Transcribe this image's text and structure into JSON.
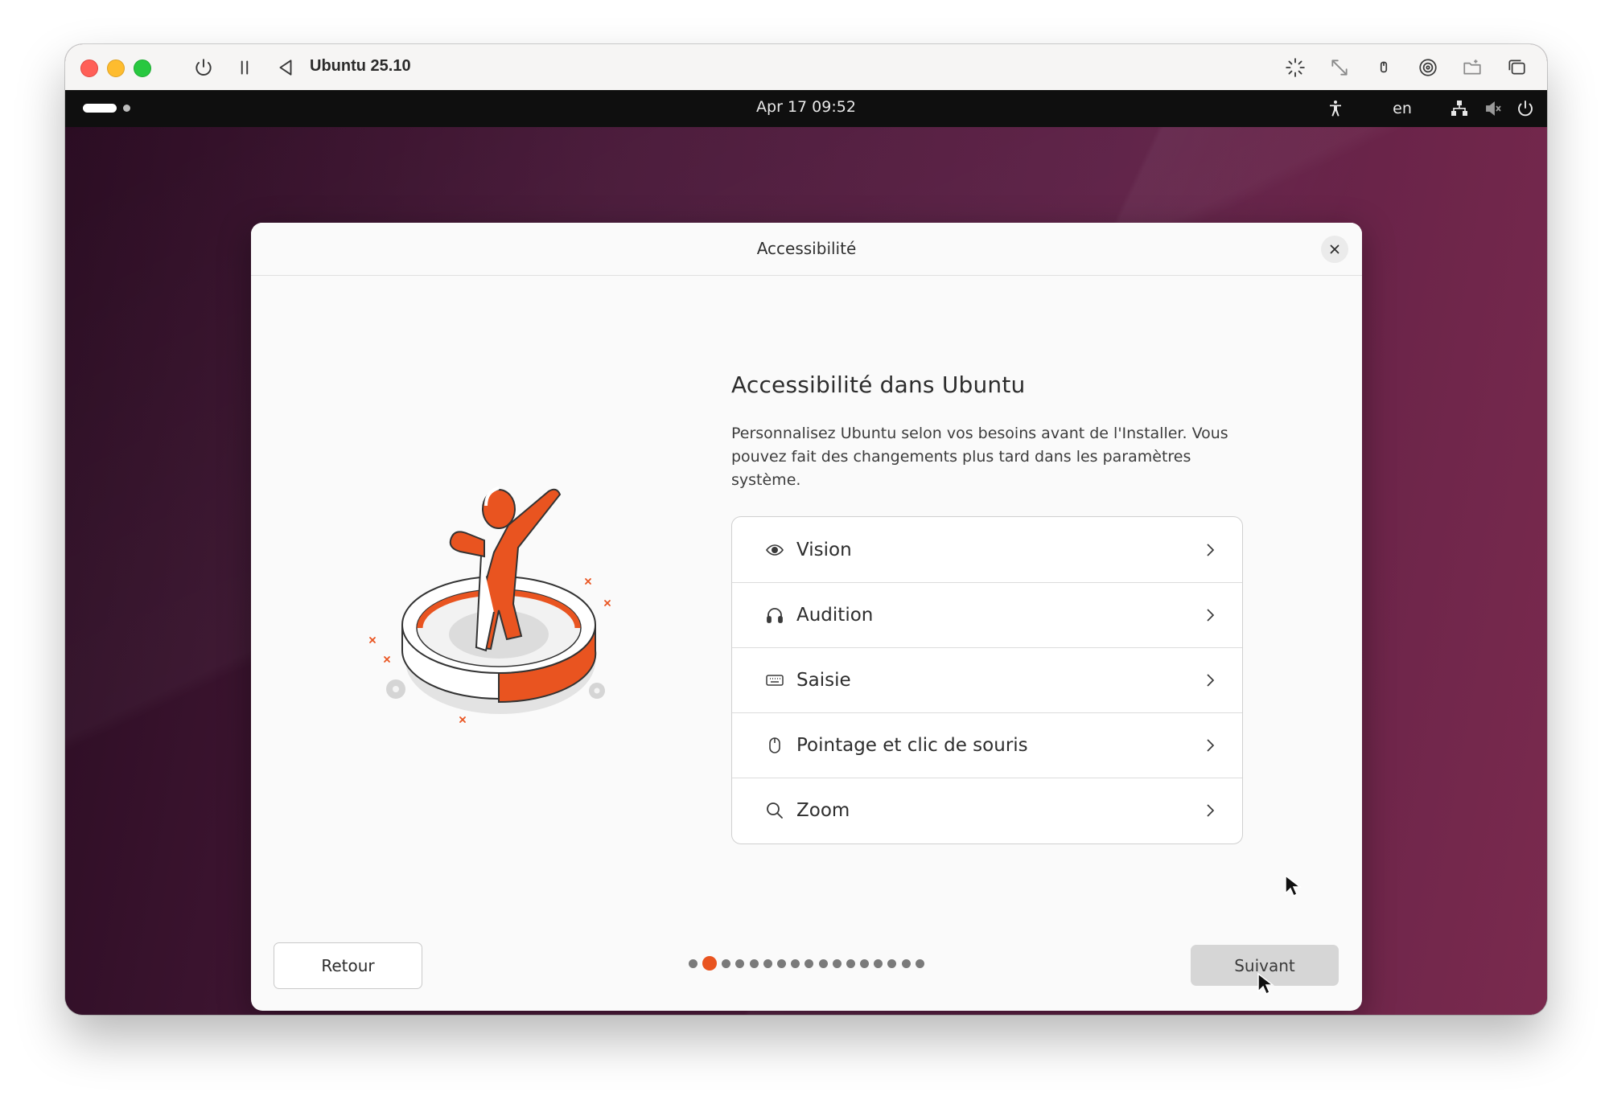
{
  "vm": {
    "title": "Ubuntu 25.10",
    "toolbar_left": [
      "power-icon",
      "pause-icon",
      "back-icon"
    ],
    "toolbar_right": [
      "capture-icon",
      "resize-icon",
      "usb-icon",
      "disc-icon",
      "shared-folder-icon",
      "window-icon"
    ]
  },
  "topbar": {
    "clock": "Apr 17  09:52",
    "lang": "en",
    "tray_icons": [
      "accessibility-icon",
      "network-icon",
      "volume-muted-icon",
      "power-icon"
    ]
  },
  "dialog": {
    "title": "Accessibilité",
    "heading": "Accessibilité dans Ubuntu",
    "description": "Personnalisez Ubuntu selon vos besoins avant de l'Installer. Vous pouvez fait des changements plus tard dans les paramètres système.",
    "items": [
      {
        "label": "Vision",
        "icon": "eye-icon"
      },
      {
        "label": "Audition",
        "icon": "headphones-icon"
      },
      {
        "label": "Saisie",
        "icon": "keyboard-icon"
      },
      {
        "label": "Pointage et clic de souris",
        "icon": "mouse-icon"
      },
      {
        "label": "Zoom",
        "icon": "magnifier-icon"
      }
    ],
    "back_label": "Retour",
    "next_label": "Suivant",
    "progress": {
      "total_steps": 17,
      "current_step": 2
    }
  },
  "colors": {
    "accent": "#e95420",
    "dialog_bg": "#fafafa",
    "topbar_bg": "#0f0f0f",
    "wallpaper": "#5d1f45"
  }
}
